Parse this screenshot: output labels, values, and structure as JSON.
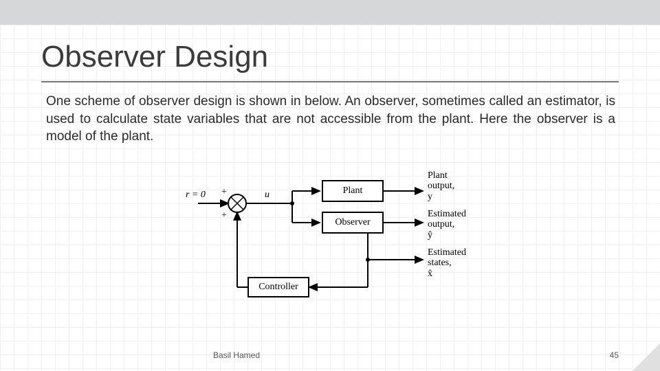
{
  "title": "Observer Design",
  "body": "One scheme of observer design is shown in below. An observer, sometimes called an estimator, is used to calculate state variables that are not accessible from the plant. Here the observer is a model of the plant.",
  "author": "Basil Hamed",
  "pagenum": "45",
  "diagram": {
    "r_label": "r = 0",
    "plus1": "+",
    "plus2": "+",
    "u": "u",
    "plant": "Plant",
    "observer": "Observer",
    "controller": "Controller",
    "plant_out": "Plant\noutput,\ny",
    "est_out": "Estimated\noutput,\nŷ",
    "est_states": "Estimated\nstates,\nx̂"
  }
}
